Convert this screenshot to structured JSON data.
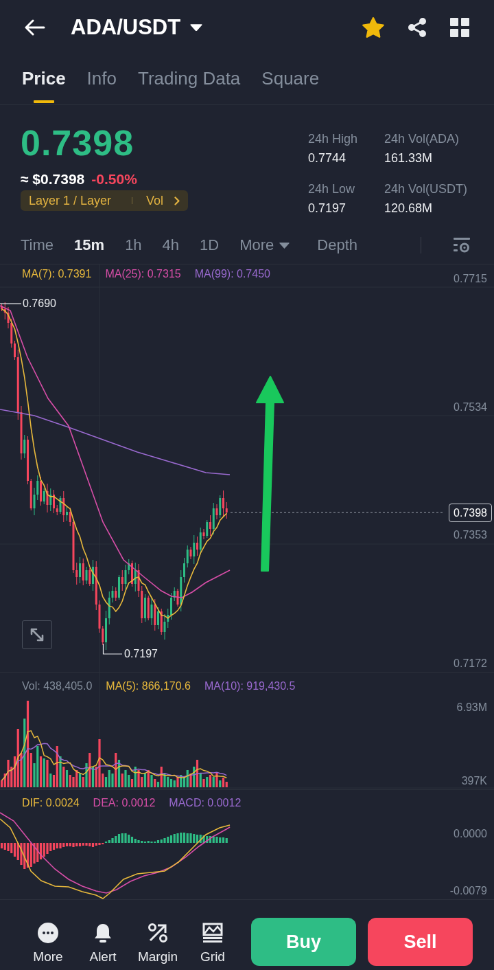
{
  "header": {
    "title": "ADA/USDT",
    "favorite": true
  },
  "tabs": [
    {
      "label": "Price",
      "selected": true
    },
    {
      "label": "Info",
      "selected": false
    },
    {
      "label": "Trading Data",
      "selected": false
    },
    {
      "label": "Square",
      "selected": false
    }
  ],
  "ticker": {
    "price": "0.7398",
    "fiat_price": "≈ $0.7398",
    "change": "-0.50%",
    "tags": [
      "Layer 1 / Layer",
      "Vol"
    ],
    "stats": [
      {
        "label": "24h High",
        "value": "0.7744"
      },
      {
        "label": "24h Vol(ADA)",
        "value": "161.33M"
      },
      {
        "label": "24h Low",
        "value": "0.7197"
      },
      {
        "label": "24h Vol(USDT)",
        "value": "120.68M"
      }
    ]
  },
  "intervals": [
    {
      "label": "Time",
      "kind": "option",
      "selected": false
    },
    {
      "label": "15m",
      "kind": "option",
      "selected": true
    },
    {
      "label": "1h",
      "kind": "option",
      "selected": false
    },
    {
      "label": "4h",
      "kind": "option",
      "selected": false
    },
    {
      "label": "1D",
      "kind": "option",
      "selected": false
    },
    {
      "label": "More",
      "kind": "menu",
      "selected": false
    },
    {
      "label": "Depth",
      "kind": "view",
      "selected": false
    }
  ],
  "price_chart": {
    "indicators": [
      {
        "label": "MA(7): 0.7391",
        "color": "#e8b93c"
      },
      {
        "label": "MA(25): 0.7315",
        "color": "#d84ea8"
      },
      {
        "label": "MA(99): 0.7450",
        "color": "#9a6ad0"
      }
    ],
    "axis_labels": [
      "0.7715",
      "0.7534",
      "0.7353",
      "0.7172"
    ],
    "high_marker": "0.7690",
    "low_marker": "0.7197",
    "last_price": "0.7398"
  },
  "volume_chart": {
    "indicators": [
      {
        "label": "Vol: 438,405.0",
        "color": "#848e9c"
      },
      {
        "label": "MA(5): 866,170.6",
        "color": "#e8b93c"
      },
      {
        "label": "MA(10): 919,430.5",
        "color": "#9a6ad0"
      }
    ],
    "axis_labels": [
      "6.93M",
      "397K"
    ]
  },
  "macd_chart": {
    "indicators": [
      {
        "label": "DIF: 0.0024",
        "color": "#e8b93c"
      },
      {
        "label": "DEA: 0.0012",
        "color": "#d84ea8"
      },
      {
        "label": "MACD: 0.0012",
        "color": "#9a6ad0"
      }
    ],
    "axis_labels": [
      "0.0000",
      "-0.0079"
    ]
  },
  "bottom_bar": {
    "actions": [
      "More",
      "Alert",
      "Margin",
      "Grid"
    ],
    "buy": "Buy",
    "sell": "Sell"
  }
}
